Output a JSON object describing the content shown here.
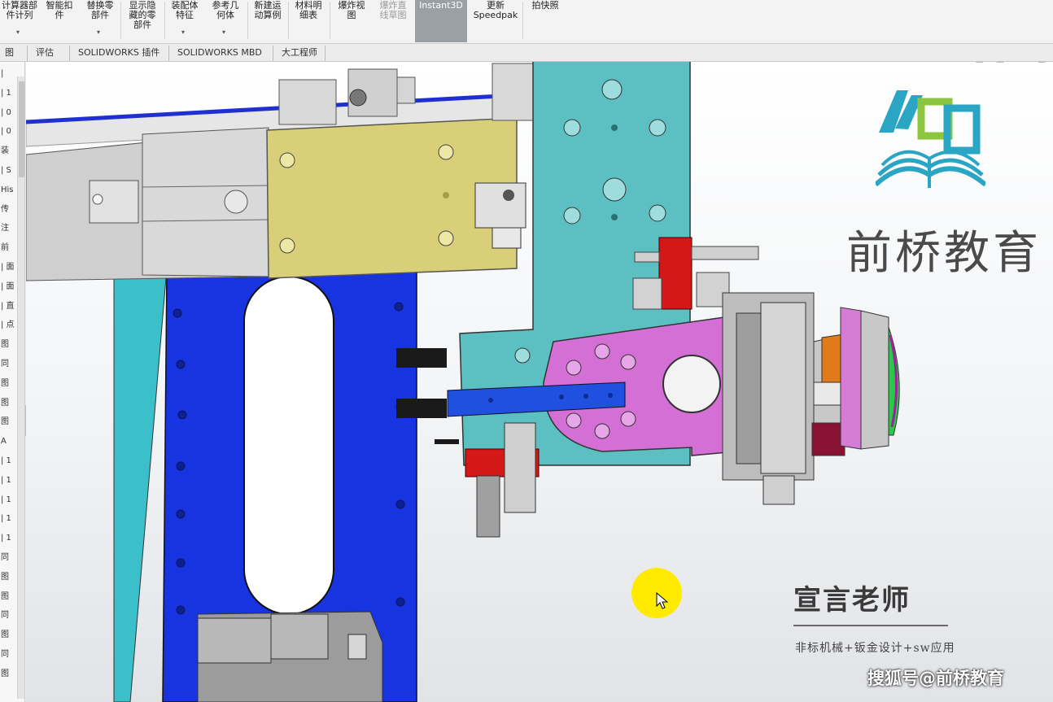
{
  "ribbon": {
    "buttons": [
      {
        "label": "计算器部\n件计列",
        "has_arrow": true
      },
      {
        "label": "智能扣\n件",
        "has_arrow": false
      },
      {
        "label": "替换零\n部件",
        "has_arrow": true
      },
      {
        "label": "显示隐\n藏的零\n部件",
        "has_arrow": false
      },
      {
        "label": "装配体\n特征",
        "has_arrow": true
      },
      {
        "label": "参考几\n何体",
        "has_arrow": true
      },
      {
        "label": "新建运\n动算例",
        "has_arrow": false
      },
      {
        "label": "材料明\n细表",
        "has_arrow": false
      },
      {
        "label": "爆炸视\n图",
        "has_arrow": false
      },
      {
        "label": "爆炸直\n线草图",
        "has_arrow": false,
        "disabled": true
      },
      {
        "label": "Instant3D",
        "has_arrow": false,
        "active": true
      },
      {
        "label": "更新\nSpeedpak",
        "has_arrow": false
      },
      {
        "label": "拍快照",
        "has_arrow": false
      }
    ]
  },
  "tabs": [
    "图",
    "评估",
    "SOLIDWORKS 插件",
    "SOLIDWORKS MBD",
    "大工程师"
  ],
  "feature_tree": {
    "rows": [
      "|",
      "| 1",
      "| 0",
      "| 0",
      "装",
      "| S",
      "His",
      "传",
      "注",
      "前",
      "| 面",
      "| 面",
      "| 直",
      "| 点",
      "图",
      "同",
      "图",
      "图",
      "图",
      "A",
      "| 1",
      "| 1",
      "| 1",
      "| 1",
      "| 1",
      "同",
      "图",
      "图",
      "同",
      "图",
      "同",
      "图"
    ]
  },
  "heads_up_icons": [
    "zoom-to-fit-icon",
    "zoom-area-icon",
    "previous-view-icon",
    "section-view-icon",
    "view-orientation-icon",
    "display-style-icon",
    "hide-show-icon",
    "edit-appearance-icon",
    "scene-icon",
    "view-settings-icon"
  ],
  "brand": {
    "name": "前桥教育",
    "teacher": "宣言老师",
    "subtitle": "非标机械+钣金设计+sw应用",
    "watermark": "搜狐号@前桥教育"
  },
  "colors": {
    "teal": "#5cc0c2",
    "blue": "#1838d8",
    "yellow": "#d9cf78",
    "magenta": "#d46fd6",
    "red": "#d41818",
    "steel": "#c8c8c8",
    "highlight": "#ffea00"
  }
}
